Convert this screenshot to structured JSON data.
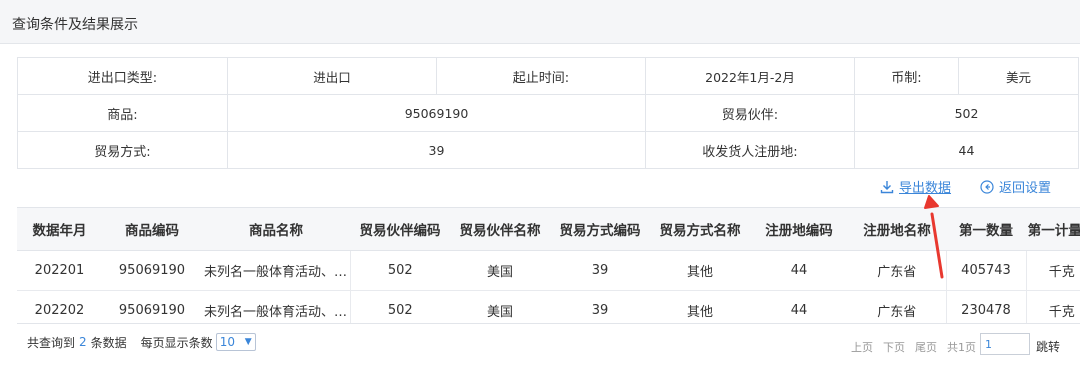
{
  "header": {
    "title": "查询条件及结果展示"
  },
  "conditions": {
    "row1": {
      "l1": "进出口类型:",
      "v1": "进出口",
      "l2": "起止时间:",
      "v2": "2022年1月-2月",
      "l3": "币制:",
      "v3": "美元"
    },
    "row2": {
      "l1": "商品:",
      "v1": "95069190",
      "l2": "贸易伙伴:",
      "v2": "502"
    },
    "row3": {
      "l1": "贸易方式:",
      "v1": "39",
      "l2": "收发货人注册地:",
      "v2": "44"
    }
  },
  "toolbar": {
    "export_label": "导出数据",
    "back_label": "返回设置"
  },
  "table": {
    "headers": [
      "数据年月",
      "商品编码",
      "商品名称",
      "贸易伙伴编码",
      "贸易伙伴名称",
      "贸易方式编码",
      "贸易方式名称",
      "注册地编码",
      "注册地名称",
      "第一数量",
      "第一计量单"
    ],
    "rows": [
      [
        "202201",
        "95069190",
        "未列名一般体育活动、…",
        "502",
        "美国",
        "39",
        "其他",
        "44",
        "广东省",
        "405743",
        "千克"
      ],
      [
        "202202",
        "95069190",
        "未列名一般体育活动、…",
        "502",
        "美国",
        "39",
        "其他",
        "44",
        "广东省",
        "230478",
        "千克"
      ]
    ]
  },
  "footer": {
    "total_prefix": "共查询到",
    "total_count": "2",
    "total_suffix": "条数据",
    "page_size_label": "每页显示条数",
    "page_size_value": "10",
    "prev": "上页",
    "next": "下页",
    "last": "尾页",
    "total_pages": "共1页",
    "page_input_value": "1",
    "goto": "跳转"
  },
  "colors": {
    "link": "#3b86d9",
    "arrow": "#e8382f"
  }
}
